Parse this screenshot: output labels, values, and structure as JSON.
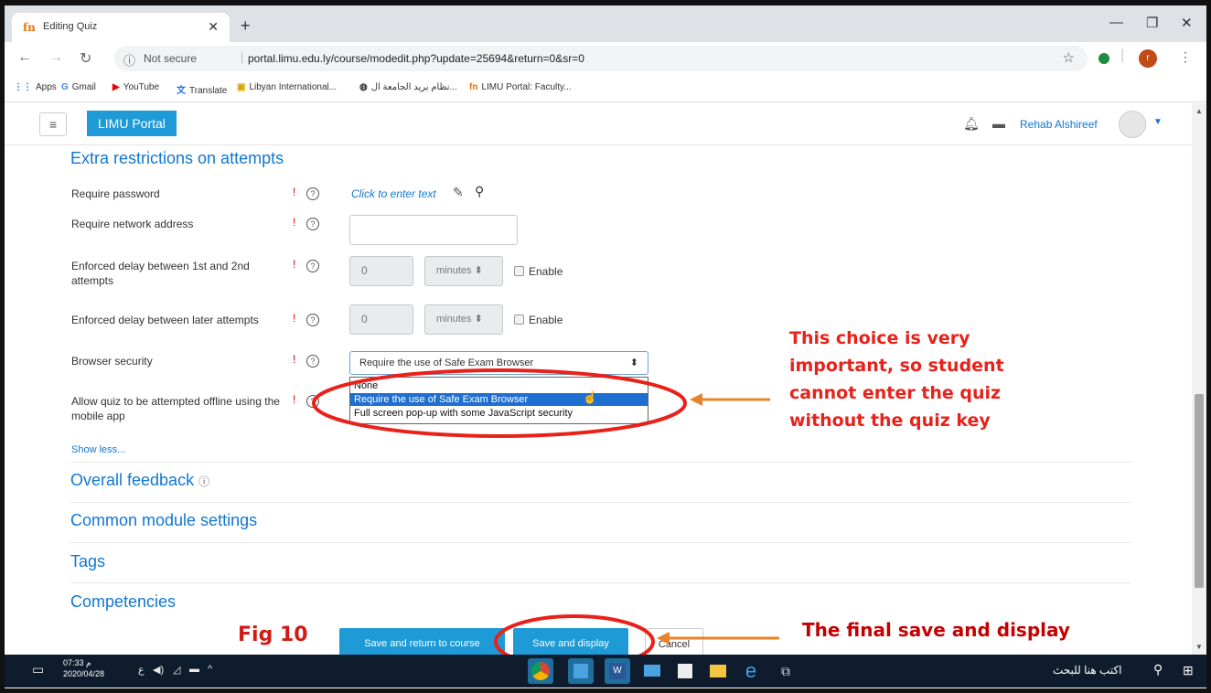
{
  "browser": {
    "tab_title": "Editing Quiz",
    "tab_favicon": "fn",
    "url_security": "Not secure",
    "url": "portal.limu.edu.ly/course/modedit.php?update=25694&return=0&sr=0",
    "profile_initial": "r",
    "bookmarks": [
      {
        "label": "Apps",
        "icon": "apps-grid-icon"
      },
      {
        "label": "Gmail",
        "icon": "google-icon"
      },
      {
        "label": "YouTube",
        "icon": "youtube-icon"
      },
      {
        "label": "Translate",
        "icon": "translate-icon"
      },
      {
        "label": "Libyan International...",
        "icon": "libyan-icon"
      },
      {
        "label": "نظام بريد الجامعة ال...",
        "icon": "globe-icon"
      },
      {
        "label": "LIMU Portal: Faculty...",
        "icon": "moodle-icon"
      }
    ]
  },
  "header": {
    "menu_icon": "≡",
    "brand": "LIMU Portal",
    "user_name": "Rehab Alshireef"
  },
  "form": {
    "section_title": "Extra restrictions on attempts",
    "fields": {
      "require_password": {
        "label": "Require password",
        "value": "Click to enter text"
      },
      "require_network": {
        "label": "Require network address",
        "value": ""
      },
      "delay_first": {
        "label": "Enforced delay between 1st and 2nd attempts",
        "value": "0",
        "unit": "minutes",
        "enable": "Enable"
      },
      "delay_later": {
        "label": "Enforced delay between later attempts",
        "value": "0",
        "unit": "minutes",
        "enable": "Enable"
      },
      "browser_security": {
        "label": "Browser security",
        "selected": "Require the use of Safe Exam Browser",
        "options": [
          "None",
          "Require the use of Safe Exam Browser",
          "Full screen pop-up with some JavaScript security"
        ]
      },
      "offline": {
        "label": "Allow quiz to be attempted offline using the mobile app"
      }
    },
    "show_less": "Show less...",
    "sections": [
      "Overall feedback",
      "Common module settings",
      "Tags",
      "Competencies"
    ],
    "buttons": {
      "save_return": "Save and return to course",
      "save_display": "Save and display",
      "cancel": "Cancel"
    }
  },
  "annotations": {
    "main_note": "This choice is very important, so student cannot enter the quiz without the quiz key",
    "fig_label": "Fig 10",
    "final_note": "The final save and display",
    "color": "#e8221b"
  },
  "taskbar": {
    "time": "07:33 م",
    "date": "2020/04/28",
    "lang": "ع",
    "search_placeholder": "اكتب هنا للبحث"
  }
}
